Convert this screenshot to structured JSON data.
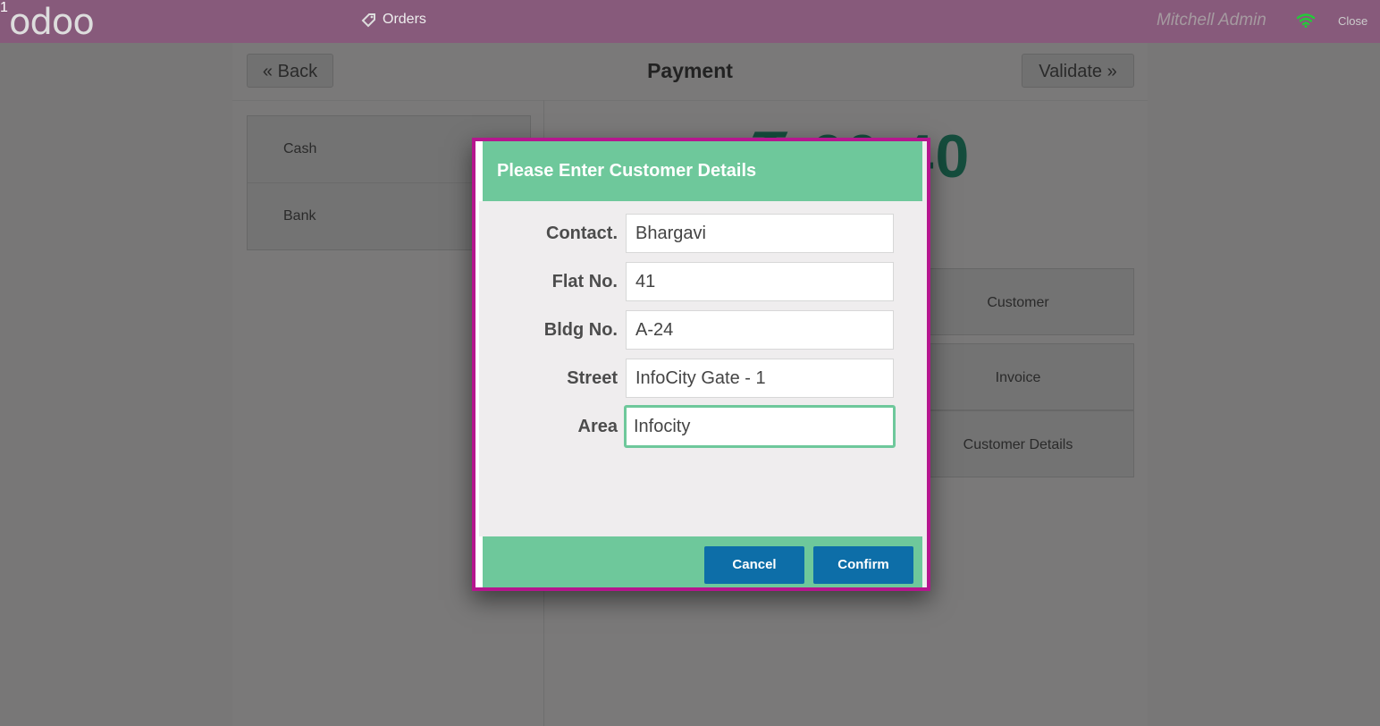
{
  "topbar": {
    "logo": "odoo",
    "orders_label": "Orders",
    "orders_count": "1",
    "user": "Mitchell Admin",
    "close_label": "Close"
  },
  "payment_screen": {
    "title": "Payment",
    "back_label": "« Back",
    "validate_label": "Validate »",
    "payment_methods": [
      "Cash",
      "Bank"
    ],
    "amount_due_partial": "₹ 60.40",
    "side_buttons": [
      "Customer",
      "Invoice",
      "Customer Details"
    ]
  },
  "popup": {
    "title": "Please Enter Customer Details",
    "fields": [
      {
        "label": "Contact.",
        "value": "Bhargavi"
      },
      {
        "label": "Flat No.",
        "value": "41"
      },
      {
        "label": "Bldg No.",
        "value": "A-24"
      },
      {
        "label": "Street",
        "value": "InfoCity Gate - 1"
      },
      {
        "label": "Area",
        "value": "Infocity"
      }
    ],
    "cancel_label": "Cancel",
    "confirm_label": "Confirm"
  },
  "colors": {
    "topbar": "#875a7b",
    "popup_header": "#6ec89b",
    "button_blue": "#0d6ea8",
    "highlight_border": "#b5168e",
    "wifi": "#25c83a"
  },
  "icons": [
    "tag-icon",
    "wifi-icon",
    "double-chevron-left-icon",
    "double-chevron-right-icon"
  ]
}
